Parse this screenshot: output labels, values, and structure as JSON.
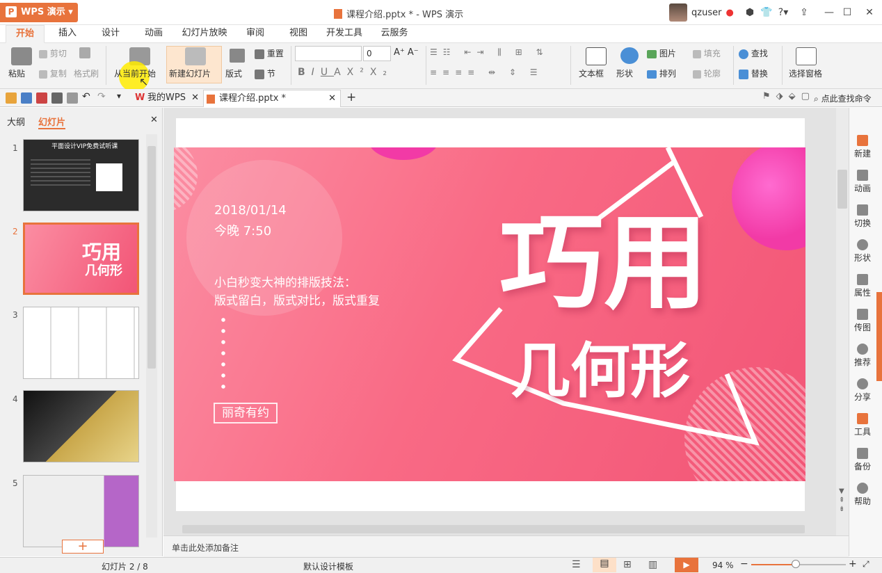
{
  "app": {
    "name": "WPS 演示",
    "logo_letter": "P",
    "window_title": "课程介绍.pptx * - WPS 演示"
  },
  "user": {
    "name": "qzuser"
  },
  "menu_tabs": [
    "开始",
    "插入",
    "设计",
    "动画",
    "幻灯片放映",
    "审阅",
    "视图",
    "开发工具",
    "云服务"
  ],
  "ribbon": {
    "paste": "粘贴",
    "cut": "剪切",
    "copy": "复制",
    "format_painter": "格式刷",
    "from_current": "从当前开始",
    "new_slide": "新建幻灯片",
    "layout": "版式",
    "reset": "重置",
    "section": "节",
    "font_size": "0",
    "textbox": "文本框",
    "shape": "形状",
    "picture": "图片",
    "fill": "填充",
    "arrange": "排列",
    "outline": "轮廓",
    "find": "查找",
    "replace": "替换",
    "selection_pane": "选择窗格",
    "bold": "B",
    "italic": "I",
    "underline": "U",
    "fontcolor": "A",
    "superscript": "X²",
    "subscript": "X₂"
  },
  "doc_tabs": [
    "我的WPS",
    "课程介绍.pptx *"
  ],
  "find_command": "点此查找命令",
  "left_panel": {
    "tabs": [
      "大纲",
      "幻灯片"
    ],
    "add_button": "+"
  },
  "thumbnails": [
    {
      "num": "1",
      "title": "平面设计VIP免费试听课"
    },
    {
      "num": "2",
      "title": "巧用",
      "subtitle": "几何形"
    },
    {
      "num": "3"
    },
    {
      "num": "4"
    },
    {
      "num": "5"
    }
  ],
  "slide": {
    "date": "2018/01/14",
    "time": "今晚 7:50",
    "line1": "小白秒变大神的排版技法：",
    "line2": "版式留白，版式对比，版式重复",
    "author": "丽奇有约",
    "title1": "巧用",
    "title2": "几何形"
  },
  "notes_placeholder": "单击此处添加备注",
  "right_bar": [
    "新建",
    "动画",
    "切换",
    "形状",
    "属性",
    "传图",
    "推荐",
    "分享",
    "工具",
    "备份",
    "帮助"
  ],
  "status": {
    "slide_index": "幻灯片 2 / 8",
    "template": "默认设计模板",
    "zoom": "94 %",
    "zoom_level": 0.47
  },
  "colors": {
    "accent": "#e8733c",
    "slide_bg": "#f96a85",
    "magenta": "#ff3fb0"
  }
}
